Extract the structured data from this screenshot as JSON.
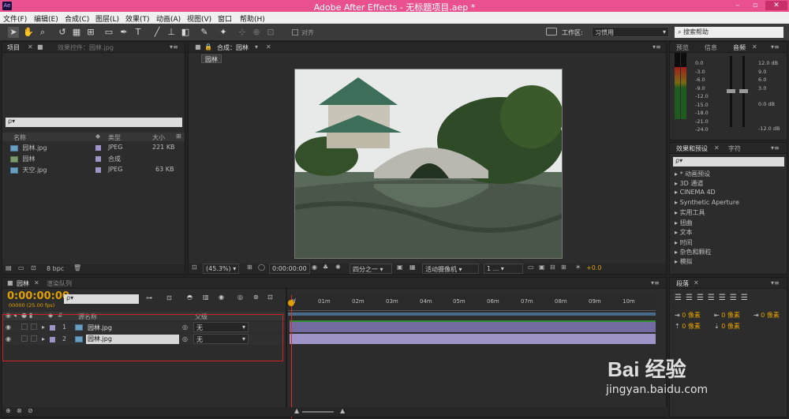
{
  "title_bar": {
    "icon": "Ae",
    "title": "Adobe After Effects - 无标题项目.aep *",
    "minimize": "–",
    "maximize": "▫",
    "close": "✕"
  },
  "menu": [
    "文件(F)",
    "编辑(E)",
    "合成(C)",
    "图层(L)",
    "效果(T)",
    "动画(A)",
    "视图(V)",
    "窗口",
    "帮助(H)"
  ],
  "toolbar": {
    "snap_label": "对齐",
    "workspace_label": "工作区:",
    "workspace_value": "习惯用",
    "search_placeholder": "搜索帮助"
  },
  "project_panel": {
    "tabs": [
      "项目",
      "效果控件：园林.jpg"
    ],
    "search_placeholder": "ρ▾",
    "columns": [
      "名称",
      "类型",
      "大小"
    ],
    "items": [
      {
        "name": "园林.jpg",
        "type": "JPEG",
        "size": "221 KB",
        "icon": "image-icon"
      },
      {
        "name": "园林",
        "type": "合成",
        "size": "",
        "icon": "composition-icon"
      },
      {
        "name": "天空.jpg",
        "type": "JPEG",
        "size": "63 KB",
        "icon": "image-icon"
      }
    ],
    "bpc": "8 bpc"
  },
  "composition_panel": {
    "tab": "合成：园林",
    "breadcrumb": "园林",
    "zoom": "(45.3%)",
    "timecode": "0:00:00:00",
    "resolution": "四分之一",
    "camera": "活动摄像机",
    "views": "1 ...",
    "exposure": "+0.0"
  },
  "audio_panel": {
    "tabs": [
      "预览",
      "信息",
      "音频"
    ],
    "left_scale": [
      "0.0",
      "-3.0",
      "-6.0",
      "-9.0",
      "-12.0",
      "-15.0",
      "-18.0",
      "-21.0",
      "-24.0"
    ],
    "right_scale": [
      "12.0 dB",
      "9.0",
      "6.0",
      "3.0",
      "0.0 dB",
      "-12.0 dB"
    ]
  },
  "effects_panel": {
    "tabs": [
      "效果和预设",
      "字符"
    ],
    "search_placeholder": "ρ▾",
    "categories": [
      "* 动画预设",
      "3D 通道",
      "CINEMA 4D",
      "Synthetic Aperture",
      "实用工具",
      "扭曲",
      "文本",
      "时间",
      "杂色和颗粒",
      "模拟"
    ]
  },
  "paragraph_panel": {
    "tab": "段落",
    "indent_values": [
      "0 像素",
      "0 像素",
      "0 像素",
      "0 像素",
      "0 像素"
    ]
  },
  "timeline": {
    "tabs": [
      "园林",
      "渲染队列"
    ],
    "timecode": "0:00:00:00",
    "fps": "00000 (25.00 fps)",
    "search_placeholder": "ρ▾",
    "columns": {
      "source": "源名称",
      "parent": "父级"
    },
    "ruler": [
      "0f",
      "01m",
      "02m",
      "03m",
      "04m",
      "05m",
      "06m",
      "07m",
      "08m",
      "09m",
      "10m"
    ],
    "layers": [
      {
        "num": "1",
        "name": "园林.jpg",
        "parent": "无"
      },
      {
        "num": "2",
        "name": "园林.jpg",
        "parent": "无"
      }
    ]
  },
  "watermark": {
    "brand": "Bai 经验",
    "url": "jingyan.baidu.com"
  },
  "colors": {
    "titlebar": "#e8518d",
    "accent_timecode": "#e0a000",
    "selection_box": "#cc2222",
    "layer_bar": "#9e94c7"
  }
}
